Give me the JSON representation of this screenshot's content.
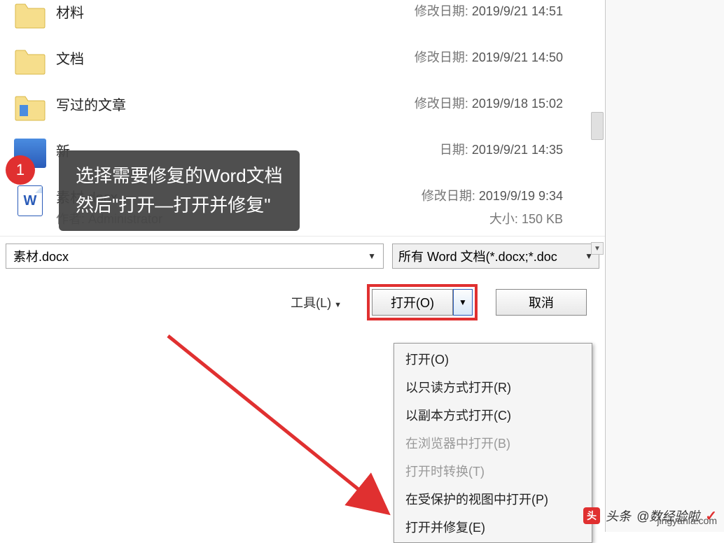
{
  "files": [
    {
      "name": "材料",
      "date_label": "修改日期:",
      "date": "2019/9/21 14:51",
      "type": "folder"
    },
    {
      "name": "文档",
      "date_label": "修改日期:",
      "date": "2019/9/21 14:50",
      "type": "folder"
    },
    {
      "name": "写过的文章",
      "date_label": "修改日期:",
      "date": "2019/9/18 15:02",
      "type": "folder"
    },
    {
      "name": "新",
      "date_label": "日期:",
      "date": "2019/9/21 14:35",
      "type": "image"
    },
    {
      "name": "素材.docx",
      "date_label": "修改日期:",
      "date": "2019/9/19 9:34",
      "type": "doc",
      "author_label": "作者:",
      "author": "Administrator",
      "size_label": "大小:",
      "size": "150 KB"
    }
  ],
  "filename_input": {
    "value": "素材.docx"
  },
  "filter": {
    "label": "所有 Word 文档(*.docx;*.doc"
  },
  "tools_label": "工具(L)",
  "open_button": "打开(O)",
  "cancel_button": "取消",
  "menu": {
    "items": [
      {
        "label": "打开(O)",
        "disabled": false
      },
      {
        "label": "以只读方式打开(R)",
        "disabled": false
      },
      {
        "label": "以副本方式打开(C)",
        "disabled": false
      },
      {
        "label": "在浏览器中打开(B)",
        "disabled": true
      },
      {
        "label": "打开时转换(T)",
        "disabled": true
      },
      {
        "label": "在受保护的视图中打开(P)",
        "disabled": false
      },
      {
        "label": "打开并修复(E)",
        "disabled": false
      }
    ]
  },
  "tooltip": {
    "line1": "选择需要修复的Word文档",
    "line2": "然后\"打开—打开并修复\""
  },
  "step_number": "1",
  "watermark": {
    "source": "头条",
    "author": "@数经验啦",
    "site": "jingyanla.com"
  }
}
